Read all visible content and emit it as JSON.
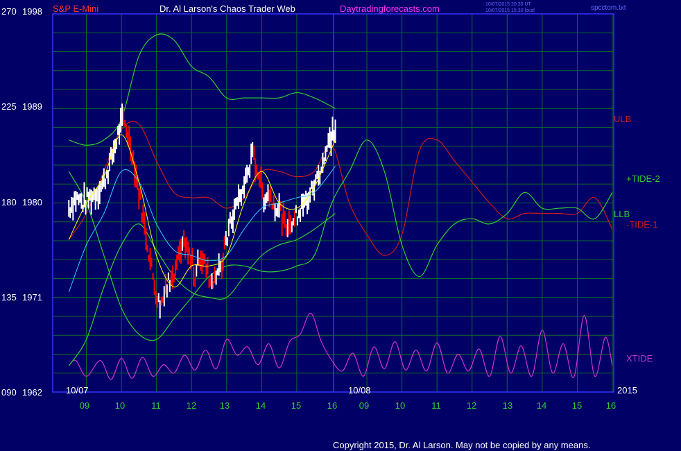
{
  "header": {
    "symbol": "S&P E-Mini",
    "title": "Dr. Al Larson's Chaos Trader Web",
    "site": "Daytradingforecasts.com",
    "stamp_ut": "10/07/2015 20:30 UT",
    "stamp_local": "10/07/2015 15:30 local",
    "filename": "spcctom.txt"
  },
  "footer": {
    "copyright": "Copyright 2015, Dr. Al Larson. May not be copied by any means."
  },
  "colors": {
    "background": "#000066",
    "frame": "#3333ff",
    "grid": "#0f6a28",
    "price": "#ffffff",
    "price_down": "#ff0000",
    "ema_fast": "#ffff00",
    "ema_slow": "#33ccff",
    "band": "#33cc33",
    "tide_plus": "#33cc33",
    "tide_minus": "#cc1a1a",
    "xtide": "#cc33cc",
    "header_red": "#ff3333",
    "header_white": "#ffffff",
    "header_magenta": "#ff33ff",
    "stamp": "#6666ff",
    "axis_text": "#ffffff",
    "hour_text": "#33cc33"
  },
  "chart_data": {
    "type": "line",
    "y_axis": {
      "range_left": [
        90,
        270
      ],
      "range_right": [
        1962,
        1998
      ],
      "ticks": [
        {
          "left": "270",
          "right": "1998"
        },
        {
          "left": "225",
          "right": "1989"
        },
        {
          "left": "180",
          "right": "1980"
        },
        {
          "left": "135",
          "right": "1971"
        },
        {
          "left": "090",
          "right": "1962"
        }
      ]
    },
    "x_axis": {
      "hours_session_1": [
        "09",
        "10",
        "11",
        "12",
        "13",
        "14",
        "15",
        "16"
      ],
      "hours_session_2": [
        "09",
        "10",
        "11",
        "12",
        "13",
        "14",
        "15",
        "16"
      ],
      "date_1": "10/07",
      "date_2": "10/08",
      "year": "2015"
    },
    "series_labels": [
      "ULB",
      "+TIDE-2",
      "LLB",
      "-TIDE-1",
      "XTIDE"
    ],
    "series": [
      {
        "name": "ULB",
        "x": [
          8.5,
          9,
          9.5,
          10,
          10.5,
          11,
          11.5,
          12,
          12.5,
          13,
          13.5,
          14,
          14.5,
          15,
          15.5,
          16.1
        ],
        "y": [
          1986,
          1985.5,
          1986,
          1988,
          1994,
          1996,
          1995.5,
          1993,
          1992,
          1990,
          1990,
          1990,
          1990,
          1990.5,
          1990,
          1989
        ]
      },
      {
        "name": "LLB",
        "x": [
          8.5,
          9,
          9.5,
          10,
          10.5,
          11,
          11.5,
          12,
          12.5,
          13,
          13.5,
          14,
          14.5,
          15,
          15.5,
          16.1
        ],
        "y": [
          1964.5,
          1967,
          1972,
          1976,
          1978,
          1975.5,
          1973,
          1971.5,
          1971,
          1971,
          1973,
          1975,
          1976,
          1976.5,
          1977.5,
          1979
        ]
      },
      {
        "name": "-TIDE-1",
        "x": [
          8.5,
          9,
          9.5,
          10,
          10.5,
          11,
          11.5,
          12,
          12.5,
          13,
          13.5,
          14,
          14.5,
          15,
          15.5,
          16,
          16.5,
          17,
          17.5,
          18,
          18.5,
          19,
          19.5,
          20,
          20.5,
          21,
          21.5,
          22,
          22.5,
          23,
          23.5,
          24
        ],
        "y": [
          1976.5,
          1979,
          1983,
          1987,
          1987.5,
          1984,
          1981,
          1980.5,
          1980.5,
          1979.5,
          1980.5,
          1983,
          1983,
          1982.5,
          1983,
          1985.5,
          1980,
          1977,
          1975,
          1977,
          1985,
          1986,
          1984,
          1982,
          1980,
          1978.5,
          1979,
          1979,
          1979,
          1979,
          1980.5,
          1977.5
        ]
      },
      {
        "name": "+TIDE-2",
        "x": [
          8.5,
          9,
          9.5,
          10,
          10.5,
          11,
          11.5,
          12,
          12.5,
          13,
          13.5,
          14,
          14.5,
          15,
          15.5,
          16,
          16.5,
          17,
          17.5,
          18,
          18.5,
          19,
          19.5,
          20,
          20.5,
          21,
          21.5,
          22,
          22.5,
          23,
          23.5,
          24
        ],
        "y": [
          1983,
          1980,
          1975,
          1970,
          1967.5,
          1967,
          1969,
          1971,
          1973,
          1974,
          1974,
          1973.5,
          1973.5,
          1974,
          1975,
          1980,
          1983,
          1986,
          1983,
          1976,
          1973,
          1976,
          1978,
          1978.5,
          1978,
          1979,
          1981,
          1979.5,
          1979.5,
          1979.5,
          1978.5,
          1981
        ]
      },
      {
        "name": "XTIDE",
        "x": [
          8.5,
          8.7,
          9,
          9.4,
          9.7,
          10,
          10.3,
          10.6,
          10.9,
          11.2,
          11.5,
          11.8,
          12.1,
          12.4,
          12.7,
          13,
          13.3,
          13.6,
          13.9,
          14.2,
          14.5,
          14.8,
          15.1,
          15.4,
          15.7,
          16,
          16.3,
          16.6,
          16.9,
          17.2,
          17.5,
          17.8,
          18.1,
          18.4,
          18.7,
          19,
          19.3,
          19.6,
          19.9,
          20.2,
          20.5,
          20.8,
          21.1,
          21.4,
          21.7,
          22,
          22.3,
          22.6,
          22.9,
          23.2,
          23.5,
          23.8,
          24
        ],
        "y": [
          1964.5,
          1965,
          1963.5,
          1965,
          1963.2,
          1965.2,
          1963.3,
          1965.3,
          1963.5,
          1964.6,
          1963.8,
          1965.5,
          1964.1,
          1966,
          1964.2,
          1967,
          1965.5,
          1966.3,
          1964.6,
          1966.6,
          1964.3,
          1966.8,
          1967.5,
          1969.5,
          1966.8,
          1965,
          1964,
          1965.7,
          1963.5,
          1966.3,
          1964.2,
          1966.8,
          1964.1,
          1966,
          1964,
          1966.7,
          1963.8,
          1965.6,
          1964,
          1966.1,
          1963.5,
          1967.3,
          1963.8,
          1966.4,
          1963.5,
          1967.9,
          1963.8,
          1966.6,
          1963.4,
          1969.3,
          1963.5,
          1967.2,
          1964.5
        ]
      }
    ],
    "price": {
      "x": [
        8.5,
        8.7,
        8.9,
        9.1,
        9.3,
        9.5,
        9.7,
        9.9,
        10.05,
        10.15,
        10.3,
        10.45,
        10.6,
        10.75,
        10.9,
        11.05,
        11.2,
        11.35,
        11.5,
        11.65,
        11.8,
        11.95,
        12.1,
        12.25,
        12.4,
        12.55,
        12.7,
        12.85,
        13,
        13.15,
        13.3,
        13.45,
        13.6,
        13.75,
        13.9,
        14.05,
        14.2,
        14.35,
        14.5,
        14.65,
        14.8,
        14.95,
        15.1,
        15.25,
        15.4,
        15.55,
        15.7,
        15.85,
        16,
        16.1
      ],
      "y": [
        1979.5,
        1980.5,
        1980,
        1980.5,
        1981,
        1982,
        1984,
        1986.5,
        1988,
        1987,
        1985,
        1982,
        1979,
        1976,
        1973,
        1970.5,
        1971,
        1972.5,
        1973,
        1975,
        1976,
        1975,
        1973,
        1975,
        1974,
        1972.5,
        1973.5,
        1974,
        1976.5,
        1978.5,
        1980,
        1981,
        1983,
        1984.5,
        1983,
        1980.5,
        1981,
        1980,
        1979.5,
        1978,
        1978.5,
        1978.5,
        1979.5,
        1980,
        1981,
        1982,
        1983.5,
        1985,
        1986.5,
        1987
      ]
    },
    "ema_fast": {
      "x": [
        8.5,
        9,
        9.5,
        10,
        10.5,
        11,
        11.5,
        12,
        12.5,
        13,
        13.5,
        14,
        14.5,
        15,
        15.5,
        16.1
      ],
      "y": [
        1976.5,
        1980,
        1982.5,
        1986.5,
        1982,
        1975,
        1972,
        1974,
        1974,
        1975,
        1980,
        1983,
        1980,
        1979.5,
        1981.5,
        1986
      ]
    },
    "ema_slow": {
      "x": [
        8.5,
        9,
        9.5,
        10,
        10.5,
        11,
        11.5,
        12,
        12.5,
        13,
        13.5,
        14,
        14.5,
        15,
        15.5,
        16.1
      ],
      "y": [
        1971.5,
        1976,
        1979,
        1983,
        1982,
        1978,
        1975.5,
        1975,
        1974.5,
        1975,
        1977.5,
        1979.5,
        1980,
        1980.5,
        1981,
        1983.5
      ]
    }
  }
}
